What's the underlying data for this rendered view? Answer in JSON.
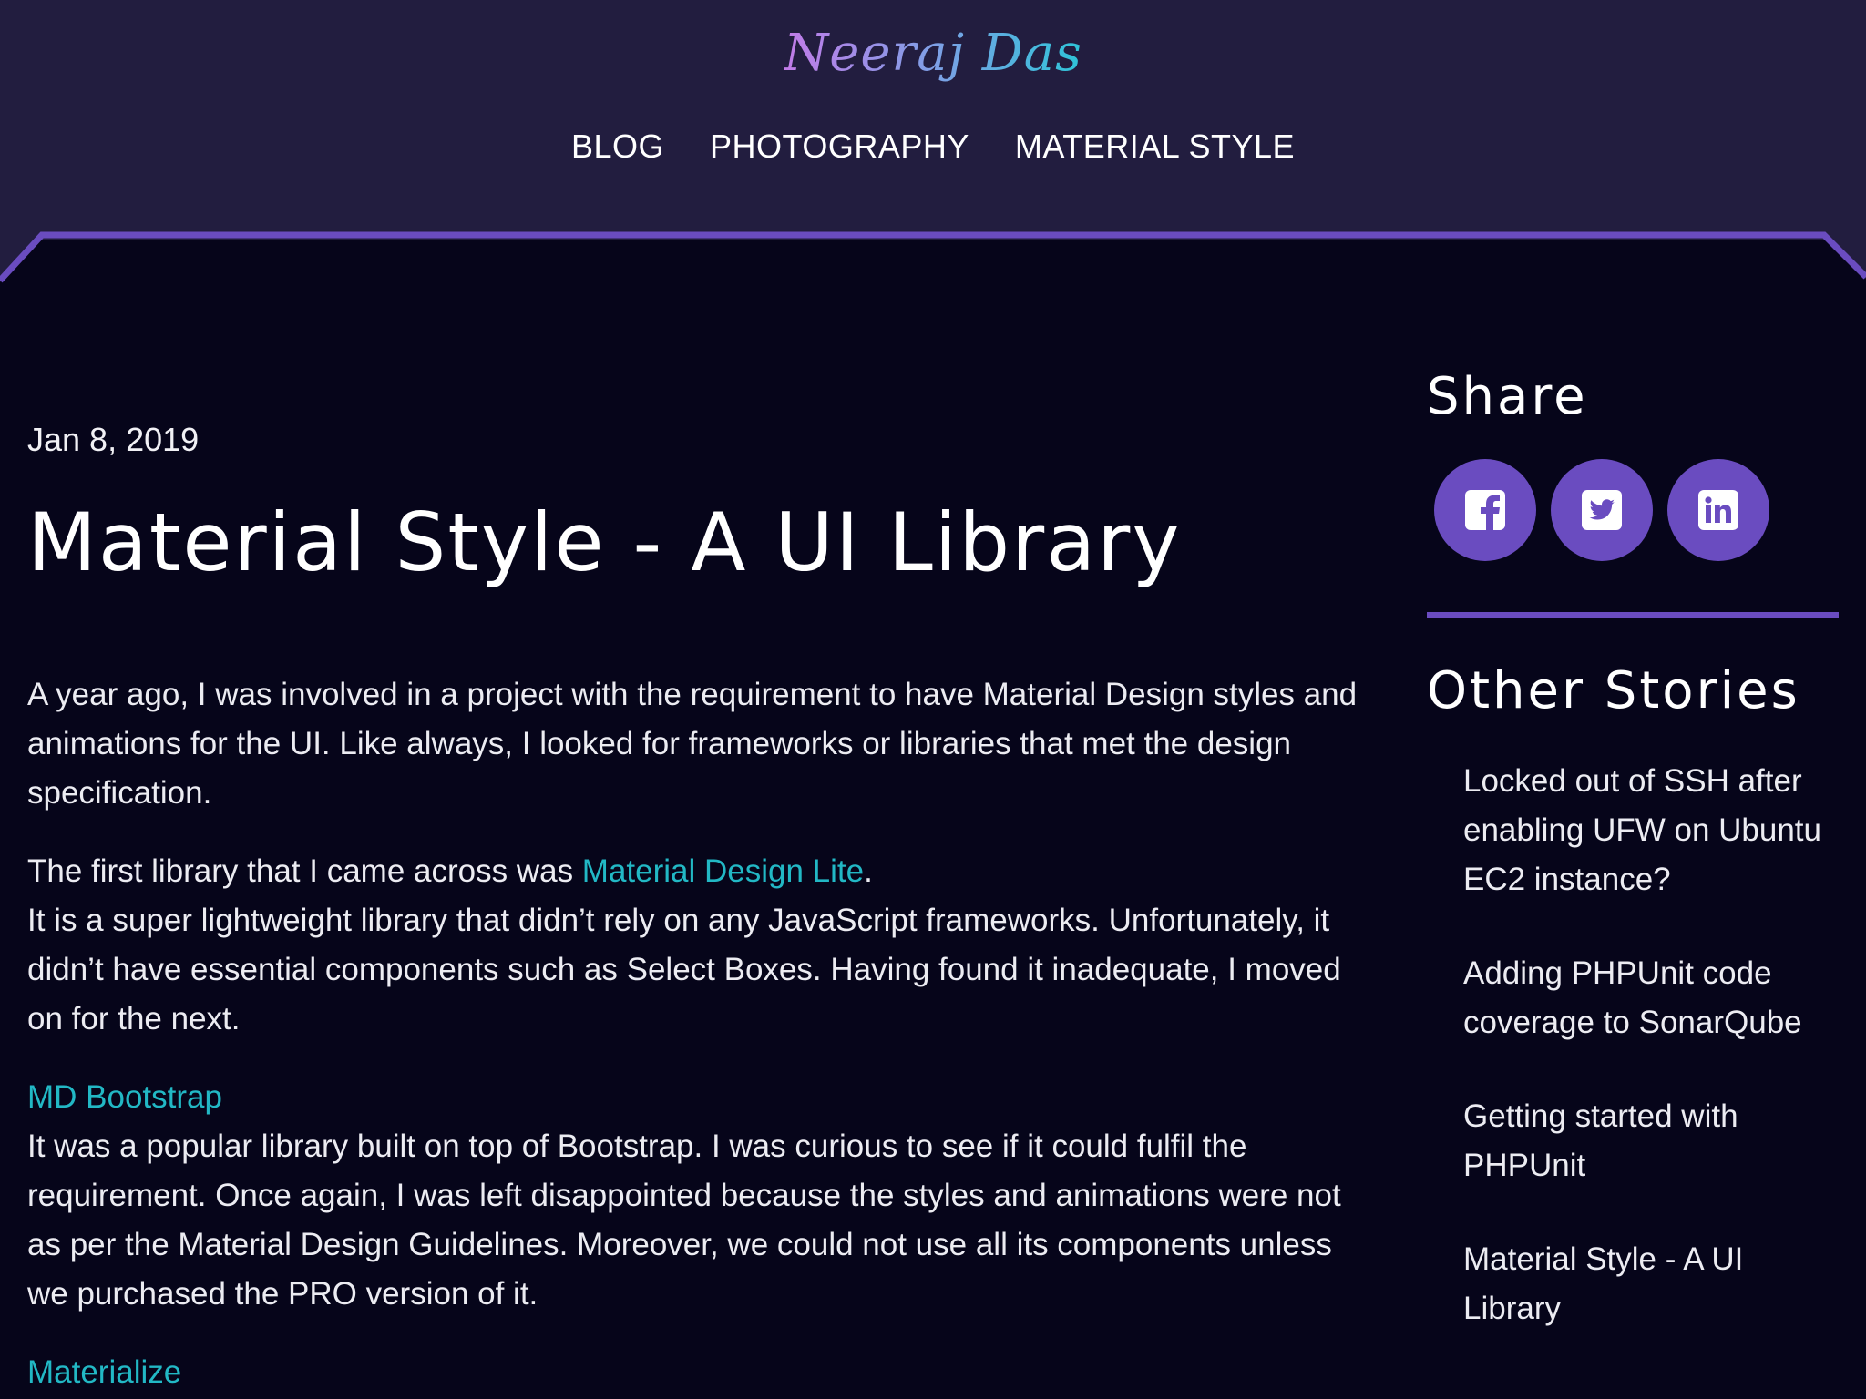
{
  "header": {
    "logo": "Neeraj Das",
    "nav": [
      {
        "label": "BLOG"
      },
      {
        "label": "PHOTOGRAPHY"
      },
      {
        "label": "MATERIAL STYLE"
      }
    ]
  },
  "article": {
    "date": "Jan 8, 2019",
    "title": "Material Style - A UI Library",
    "p1": "A year ago, I was involved in a project with the requirement to have Material Design styles and animations for the UI. Like always, I looked for frameworks or libraries that met the design specification.",
    "p2_pre": "The first library that I came across was ",
    "p2_link": "Material Design Lite",
    "p2_post": ".",
    "p2_body": "It is a super lightweight library that didn’t rely on any JavaScript frameworks. Unfortunately, it didn’t have essential components such as Select Boxes. Having found it inadequate, I moved on for the next.",
    "p3_heading": "MD Bootstrap",
    "p3_body": "It was a popular library built on top of Bootstrap. I was curious to see if it could fulfil the requirement. Once again, I was left disappointed because the styles and animations were not as per the Material Design Guidelines. Moreover, we could not use all its components unless we purchased the PRO version of it.",
    "p4_heading": "Materialize"
  },
  "sidebar": {
    "share_heading": "Share",
    "share_icons": [
      "facebook-icon",
      "twitter-icon",
      "linkedin-icon"
    ],
    "other_heading": "Other Stories",
    "stories": [
      {
        "title": "Locked out of SSH after enabling UFW on Ubuntu EC2 instance?"
      },
      {
        "title": "Adding PHPUnit code coverage to SonarQube"
      },
      {
        "title": "Getting started with PHPUnit"
      },
      {
        "title": "Material Style - A UI Library"
      }
    ]
  },
  "colors": {
    "header_bg": "#221d3f",
    "page_bg": "#06051a",
    "accent": "#6a4cc0",
    "link": "#22b8c5"
  }
}
